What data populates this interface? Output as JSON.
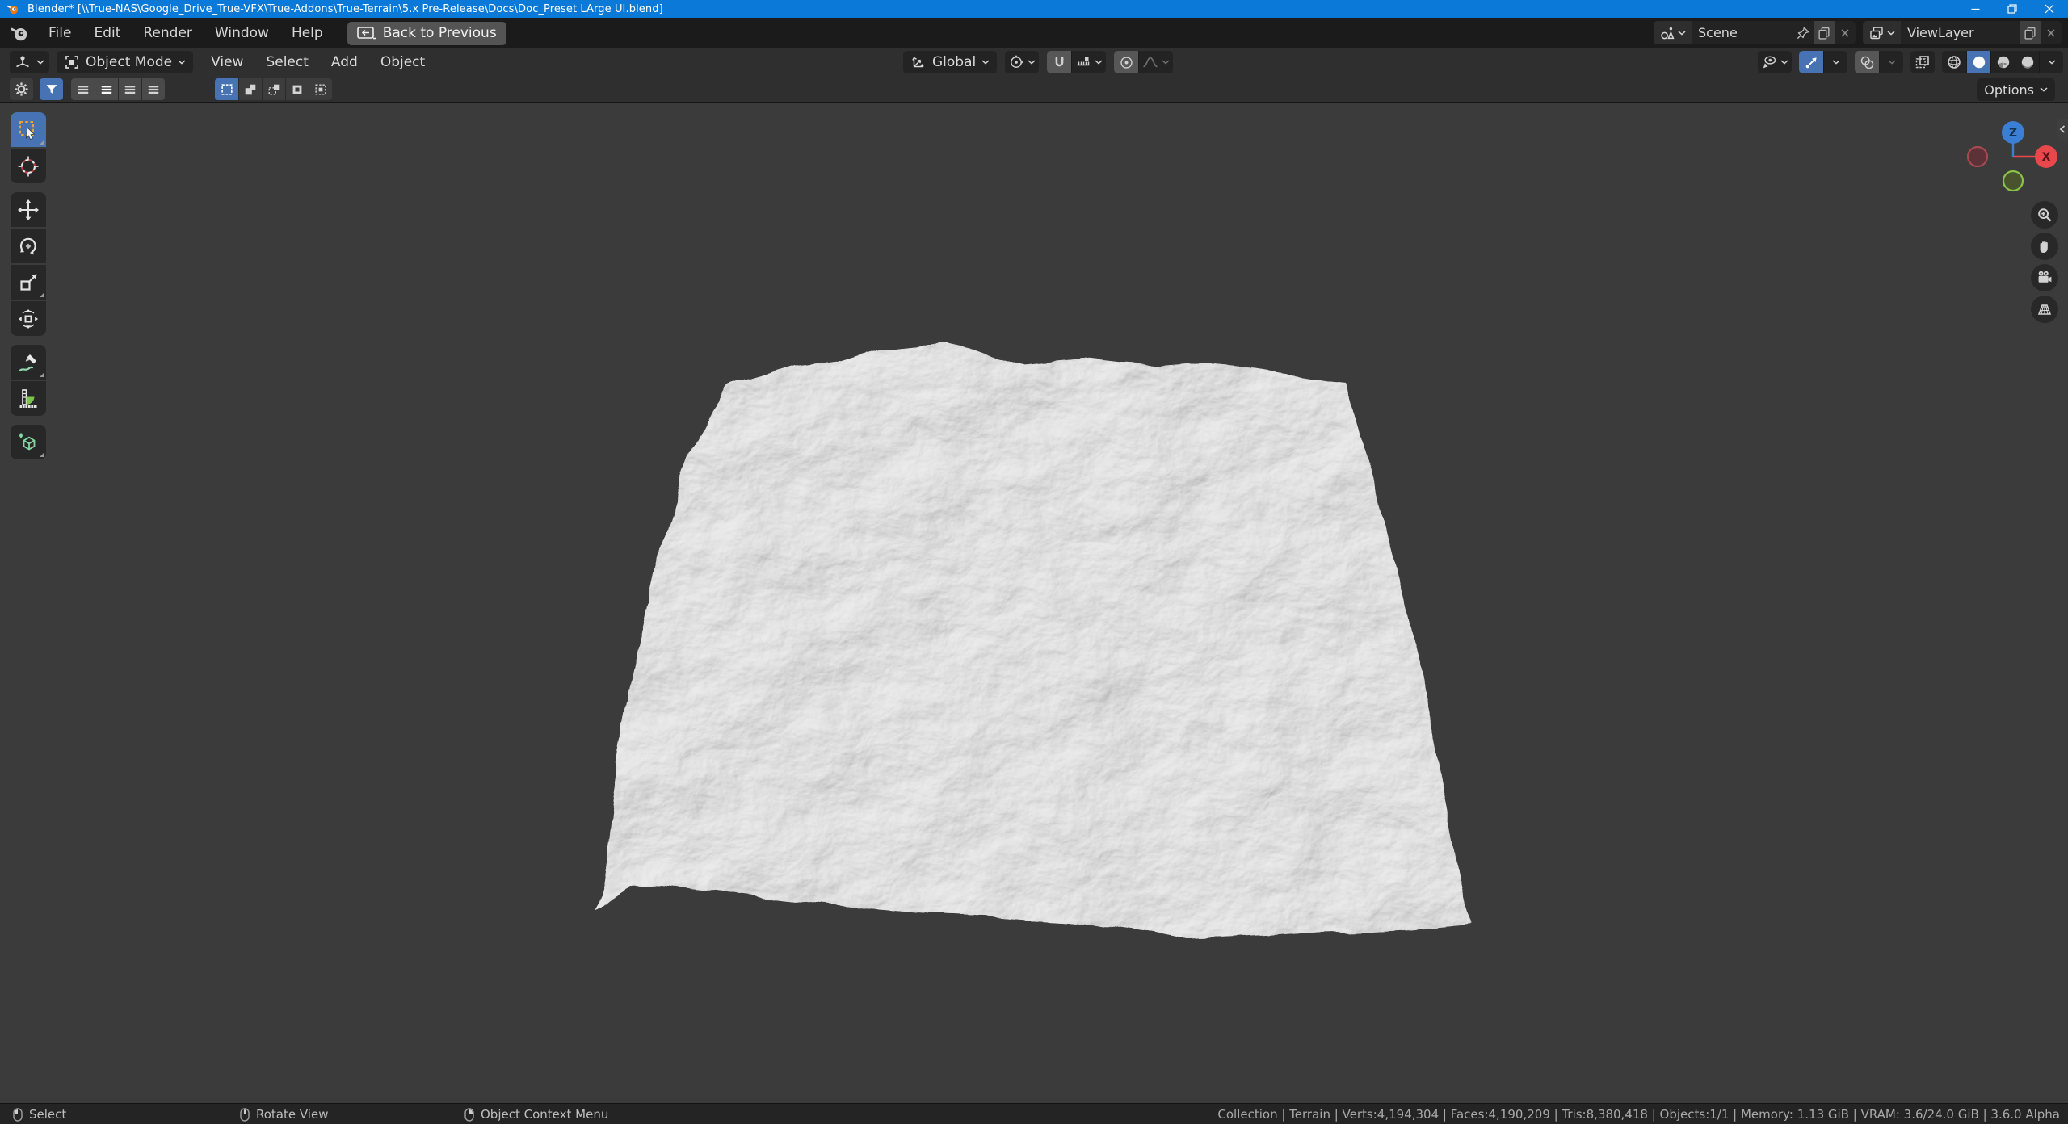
{
  "colors": {
    "titlebar": "#0b79d7",
    "accent_blue": "#4772b3",
    "viewport_bg": "#3b3b3b",
    "header_bg": "#2f2f2f",
    "menubar_bg": "#1b1b1b",
    "axis_x_red": "#e8474b",
    "axis_z_blue": "#3a7fd5",
    "axis_y_green": "#8bc34a",
    "terrain_gray": "#c6c6c6"
  },
  "window": {
    "title": "Blender* [\\\\True-NAS\\Google_Drive_True-VFX\\True-Addons\\True-Terrain\\5.x Pre-Release\\Docs\\Doc_Preset LArge UI.blend]"
  },
  "menubar": {
    "menus": [
      "File",
      "Edit",
      "Render",
      "Window",
      "Help"
    ],
    "back_label": "Back to Previous",
    "scene_label": "Scene",
    "viewlayer_label": "ViewLayer"
  },
  "header": {
    "mode_label": "Object Mode",
    "menus": [
      "View",
      "Select",
      "Add",
      "Object"
    ],
    "orientation_label": "Global",
    "options_label": "Options"
  },
  "gizmo": {
    "z_label": "Z",
    "x_label": "X"
  },
  "statusbar": {
    "hints": [
      {
        "icon": "mouse-left-icon",
        "label": "Select"
      },
      {
        "icon": "mouse-middle-icon",
        "label": "Rotate View"
      },
      {
        "icon": "mouse-right-icon",
        "label": "Object Context Menu"
      }
    ],
    "stats": "Collection | Terrain | Verts:4,194,304 | Faces:4,190,209 | Tris:8,380,418 | Objects:1/1 | Memory: 1.13 GiB | VRAM: 3.6/24.0 GiB | 3.6.0 Alpha"
  },
  "icons": {
    "toolbar": [
      "select-box",
      "cursor",
      "move",
      "rotate",
      "scale",
      "transform",
      "annotate",
      "measure",
      "add-cube"
    ],
    "nav": [
      "zoom",
      "pan",
      "camera",
      "orthographic-grid"
    ],
    "shading": [
      "wireframe",
      "solid",
      "material-preview",
      "rendered"
    ]
  }
}
